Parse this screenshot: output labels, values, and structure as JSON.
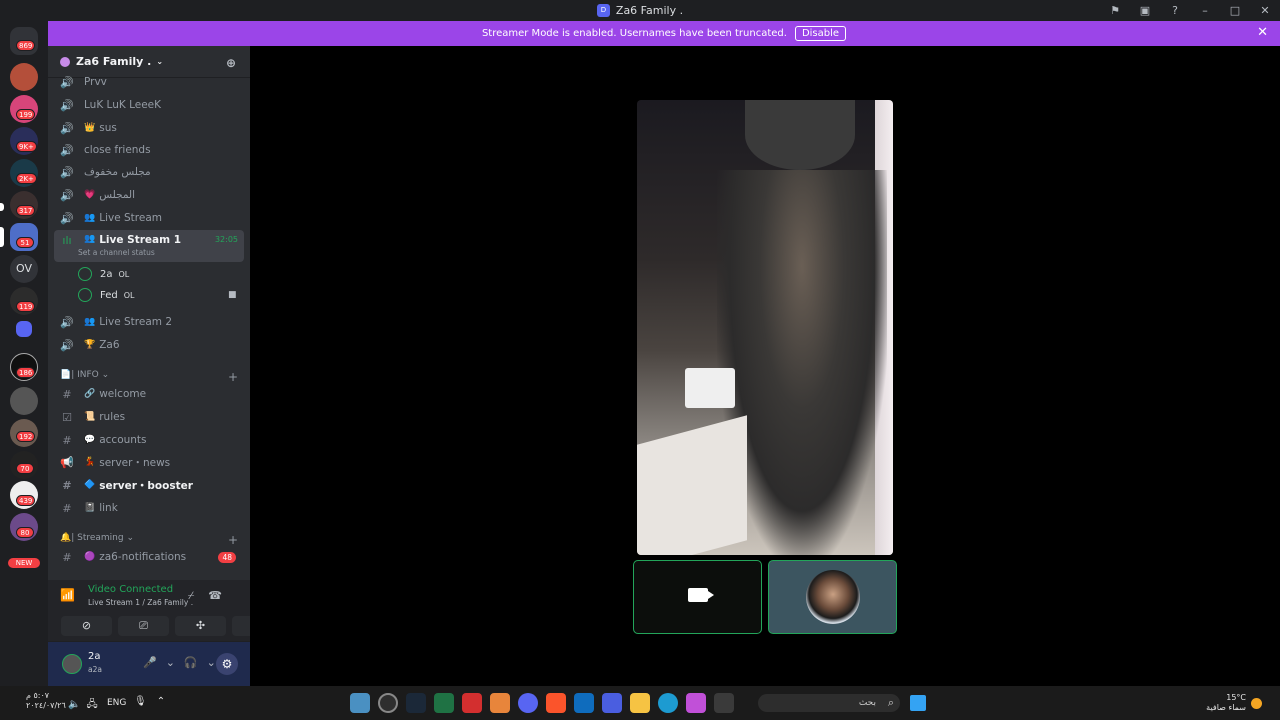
{
  "window": {
    "title": "Za6 Family ."
  },
  "banner": {
    "text": "Streamer Mode is enabled. Usernames have been truncated.",
    "button": "Disable"
  },
  "servers": {
    "badges": [
      "869",
      "199",
      "9K+",
      "2K+",
      "317",
      "51",
      "119",
      "186",
      "192",
      "70",
      "439",
      "80",
      "NEW"
    ],
    "text_icon": "OV"
  },
  "guild": {
    "name": "Za6 Family ."
  },
  "channels": {
    "prvv": "Prvv",
    "luk": "LuK LuK LeeeK",
    "sus": "sus",
    "close_friends": "close friends",
    "majlis_closed": "مجلس مخفوف",
    "majlis": "المجلس",
    "live_stream": "Live Stream",
    "live_stream_1": "Live Stream 1",
    "live_stream_1_time": "32:05",
    "live_stream_1_status": "Set a channel status",
    "live_stream_2": "Live Stream 2",
    "za6": "Za6",
    "info_category": "| INFO",
    "welcome": "welcome",
    "rules": "rules",
    "accounts": "accounts",
    "server_news": "server・news",
    "server_booster": "server・booster",
    "link": "link",
    "streaming_category": "| Streaming",
    "za6_notifications": "za6-notifications",
    "za6_notifications_count": "48"
  },
  "voice_users": [
    {
      "name": "2a",
      "tag": "OL"
    },
    {
      "name": "Fed",
      "tag": "OL"
    }
  ],
  "voice_panel": {
    "title": "Video Connected",
    "subtitle": "Live Stream 1 / Za6 Family ."
  },
  "user_panel": {
    "name": "2a",
    "status": "a2a"
  },
  "taskbar": {
    "time": "٥:٠٧ م",
    "date": "٢٠٢٤/٠٧/٢٦",
    "language": "ENG",
    "search_placeholder": "بحث",
    "temperature": "15°C",
    "weather": "سماء صافية"
  },
  "colors": {
    "accent": "#5865f2",
    "streamer_banner": "#9b45e8",
    "connected": "#23a55a",
    "badge": "#f23f43"
  }
}
